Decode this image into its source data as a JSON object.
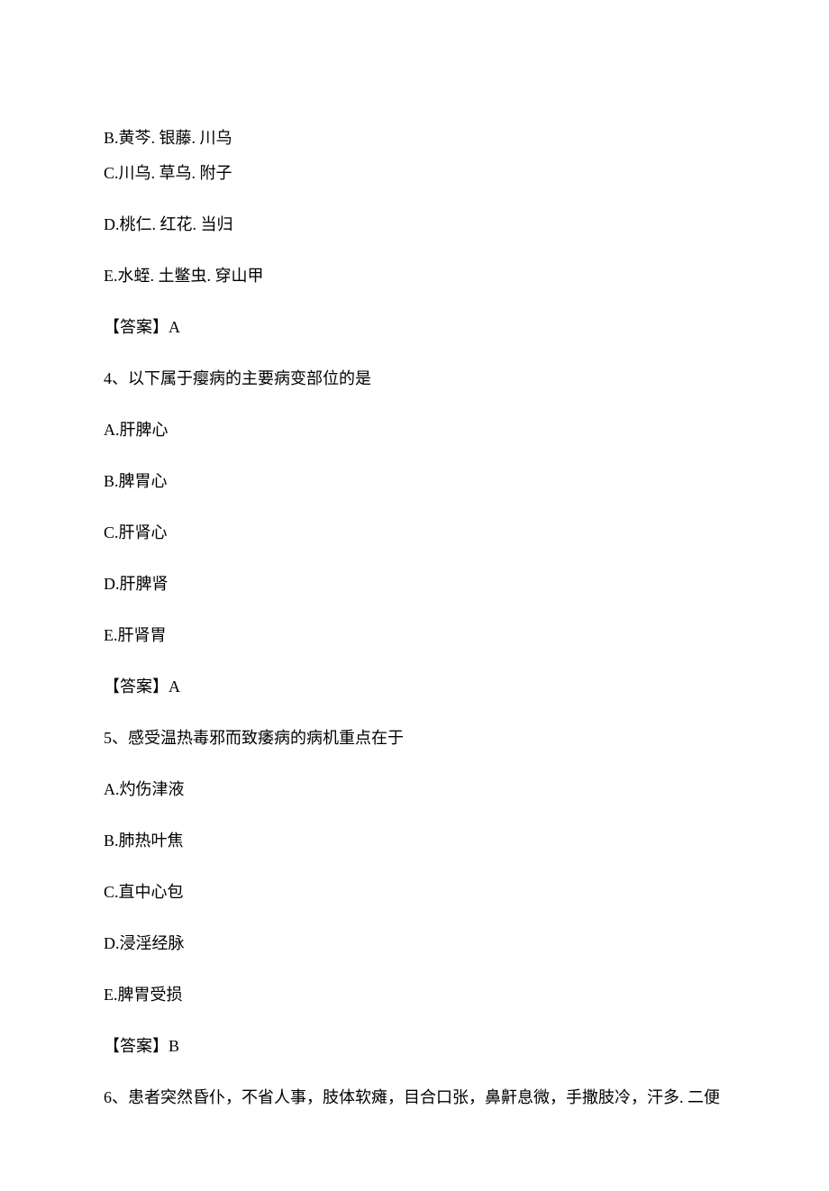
{
  "q3": {
    "optB": "B.黄芩. 银藤. 川乌",
    "optC": "C.川乌. 草乌. 附子",
    "optD": "D.桃仁. 红花. 当归",
    "optE": "E.水蛭. 土鳖虫. 穿山甲",
    "answer": "【答案】A"
  },
  "q4": {
    "stem": "4、以下属于瘿病的主要病变部位的是",
    "optA": "A.肝脾心",
    "optB": "B.脾胃心",
    "optC": "C.肝肾心",
    "optD": "D.肝脾肾",
    "optE": "E.肝肾胃",
    "answer": "【答案】A"
  },
  "q5": {
    "stem": "5、感受温热毒邪而致痿病的病机重点在于",
    "optA": "A.灼伤津液",
    "optB": "B.肺热叶焦",
    "optC": "C.直中心包",
    "optD": "D.浸淫经脉",
    "optE": "E.脾胃受损",
    "answer": "【答案】B"
  },
  "q6": {
    "stem": "6、患者突然昏仆，不省人事，肢体软瘫，目合口张，鼻鼾息微，手撒肢冷，汗多. 二便"
  }
}
